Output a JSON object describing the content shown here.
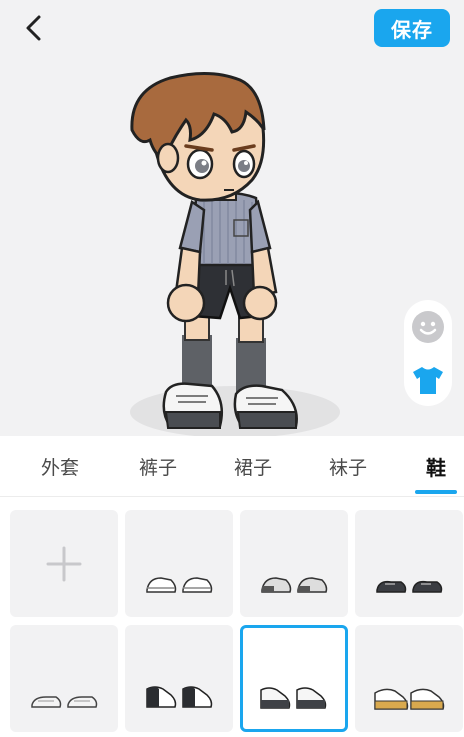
{
  "header": {
    "back_icon": "chevron-left-icon",
    "save_label": "保存"
  },
  "side_tools": [
    {
      "name": "face",
      "icon": "smiley-face-icon"
    },
    {
      "name": "clothing",
      "icon": "tshirt-icon",
      "active": true
    }
  ],
  "tabs": [
    {
      "label": "外套",
      "active": false
    },
    {
      "label": "裤子",
      "active": false
    },
    {
      "label": "裙子",
      "active": false
    },
    {
      "label": "袜子",
      "active": false
    },
    {
      "label": "鞋",
      "active": true
    }
  ],
  "grid": {
    "add_icon": "plus-icon",
    "items": [
      {
        "id": "add",
        "type": "add"
      },
      {
        "id": "shoe-1",
        "style": "white-sneaker"
      },
      {
        "id": "shoe-2",
        "style": "grey-white-sneaker"
      },
      {
        "id": "shoe-3",
        "style": "black-low-shoe"
      },
      {
        "id": "shoe-4",
        "style": "white-slip-on"
      },
      {
        "id": "shoe-5",
        "style": "black-white-hightop"
      },
      {
        "id": "shoe-6",
        "style": "dark-white-sneaker",
        "selected": true
      },
      {
        "id": "shoe-7",
        "style": "tan-white-shoe"
      }
    ]
  },
  "colors": {
    "accent": "#1aa6ee",
    "background": "#f2f2f3",
    "tab_text": "#4a4a4a",
    "active_tab_text": "#111111"
  }
}
